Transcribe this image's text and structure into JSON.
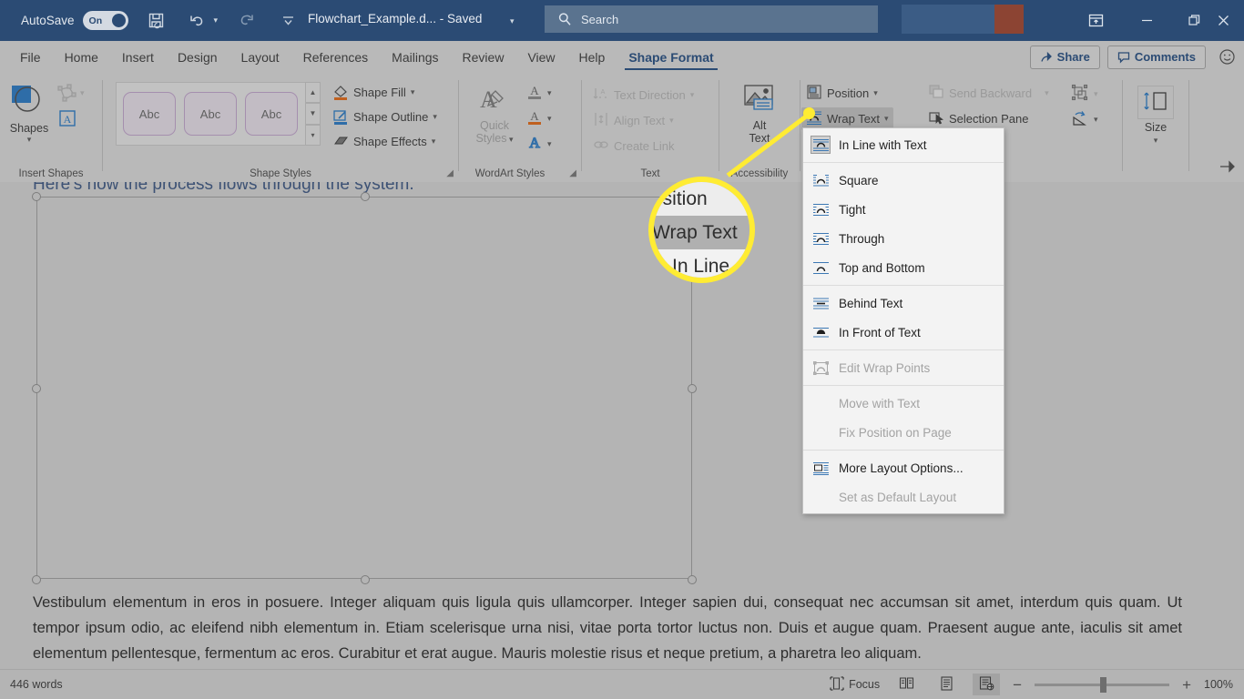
{
  "titlebar": {
    "autosave_label": "AutoSave",
    "autosave_state": "On",
    "doc_title": "Flowchart_Example.d... - Saved",
    "save_icon": "save-icon",
    "undo_icon": "undo-icon",
    "redo_icon": "redo-icon",
    "customize_icon": "customize-quick-access-icon",
    "search_icon": "search-icon",
    "search_placeholder": "Search",
    "ribbon_display_icon": "ribbon-display-options-icon",
    "minimize_icon": "minimize-icon",
    "restore_icon": "restore-icon",
    "close_icon": "close-icon"
  },
  "tabs": [
    {
      "label": "File",
      "active": false
    },
    {
      "label": "Home",
      "active": false
    },
    {
      "label": "Insert",
      "active": false
    },
    {
      "label": "Design",
      "active": false
    },
    {
      "label": "Layout",
      "active": false
    },
    {
      "label": "References",
      "active": false
    },
    {
      "label": "Mailings",
      "active": false
    },
    {
      "label": "Review",
      "active": false
    },
    {
      "label": "View",
      "active": false
    },
    {
      "label": "Help",
      "active": false
    },
    {
      "label": "Shape Format",
      "active": true
    }
  ],
  "tabbar_right": {
    "share_label": "Share",
    "share_icon": "share-icon",
    "comments_label": "Comments",
    "comments_icon": "comment-icon",
    "smiley_icon": "feedback-smiley-icon"
  },
  "ribbon": {
    "groups": [
      {
        "name": "Insert Shapes",
        "label": "Insert Shapes"
      },
      {
        "name": "Shape Styles",
        "label": "Shape Styles"
      },
      {
        "name": "WordArt Styles",
        "label": "WordArt Styles"
      },
      {
        "name": "Text",
        "label": "Text"
      },
      {
        "name": "Accessibility",
        "label": "Accessibility"
      },
      {
        "name": "Arrange",
        "label": ""
      },
      {
        "name": "Size",
        "label": ""
      }
    ],
    "insert_shapes": {
      "shapes_label": "Shapes",
      "shapes_icon": "shapes-icon",
      "edit_shape_icon": "edit-shape-icon",
      "text_box_icon": "draw-text-box-icon"
    },
    "shape_styles": {
      "gallery_items": [
        "Abc",
        "Abc",
        "Abc"
      ],
      "scroll_up_icon": "scroll-up-icon",
      "scroll_down_icon": "scroll-down-icon",
      "more_icon": "gallery-more-icon",
      "shape_fill": "Shape Fill",
      "shape_fill_icon": "shape-fill-icon",
      "shape_outline": "Shape Outline",
      "shape_outline_icon": "shape-outline-icon",
      "shape_effects": "Shape Effects",
      "shape_effects_icon": "shape-effects-icon",
      "dialog_launcher_icon": "dialog-launcher-icon"
    },
    "wordart_styles": {
      "quick_styles_line1": "Quick",
      "quick_styles_line2": "Styles",
      "quick_styles_icon": "wordart-quick-styles-icon",
      "text_fill_icon": "text-fill-icon",
      "text_outline_icon": "text-outline-icon",
      "text_effects_icon": "text-effects-icon",
      "dialog_launcher_icon": "dialog-launcher-icon"
    },
    "text_group": {
      "text_direction": "Text Direction",
      "text_direction_icon": "text-direction-icon",
      "align_text": "Align Text",
      "align_text_icon": "align-text-icon",
      "create_link": "Create Link",
      "create_link_icon": "create-link-icon"
    },
    "accessibility": {
      "alt_text_line1": "Alt",
      "alt_text_line2": "Text",
      "alt_text_icon": "alt-text-icon"
    },
    "arrange": {
      "position": "Position",
      "position_icon": "position-icon",
      "wrap_text": "Wrap Text",
      "wrap_text_icon": "wrap-text-icon",
      "bring_forward_icon": "bring-forward-icon",
      "send_backward": "Send Backward",
      "send_backward_icon": "send-backward-icon",
      "selection_pane": "Selection Pane",
      "selection_pane_icon": "selection-pane-icon",
      "align_objects_icon": "align-objects-icon",
      "group_icon": "group-objects-icon",
      "rotate_icon": "rotate-objects-icon"
    },
    "size": {
      "size_label": "Size",
      "size_icon": "size-icon"
    },
    "collapse_ribbon_icon": "pin-ribbon-icon"
  },
  "wrap_menu": {
    "items": [
      {
        "label": "In Line with Text",
        "icon": "wrap-inline-icon",
        "state": "selected"
      },
      {
        "label": "Square",
        "icon": "wrap-square-icon",
        "state": "normal"
      },
      {
        "label": "Tight",
        "icon": "wrap-tight-icon",
        "state": "normal"
      },
      {
        "label": "Through",
        "icon": "wrap-through-icon",
        "state": "normal"
      },
      {
        "label": "Top and Bottom",
        "icon": "wrap-top-bottom-icon",
        "state": "normal"
      },
      {
        "label": "Behind Text",
        "icon": "wrap-behind-text-icon",
        "state": "normal"
      },
      {
        "label": "In Front of Text",
        "icon": "wrap-in-front-icon",
        "state": "normal"
      },
      {
        "label": "Edit Wrap Points",
        "icon": "edit-wrap-points-icon",
        "state": "disabled"
      },
      {
        "label": "Move with Text",
        "icon": "",
        "state": "disabled"
      },
      {
        "label": "Fix Position on Page",
        "icon": "",
        "state": "disabled"
      },
      {
        "label": "More Layout Options...",
        "icon": "more-layout-options-icon",
        "state": "normal"
      },
      {
        "label": "Set as Default Layout",
        "icon": "",
        "state": "disabled"
      }
    ]
  },
  "callout": {
    "rows": [
      "osition",
      "Wrap Text",
      "In Line"
    ],
    "highlight_color": "#ffec33"
  },
  "document": {
    "heading": "Here's how the process flows through the system.",
    "body": "Vestibulum elementum in eros in posuere. Integer aliquam quis ligula quis ullamcorper. Integer sapien dui, consequat nec accumsan sit amet, interdum quis quam. Ut tempor ipsum odio, ac eleifend nibh elementum in. Etiam scelerisque urna nisi, vitae porta tortor luctus non. Duis et augue quam. Praesent augue ante, iaculis sit amet elementum pellentesque, fermentum ac eros. Curabitur et erat augue. Mauris molestie risus et neque pretium, a pharetra leo aliquam."
  },
  "statusbar": {
    "word_count": "446 words",
    "focus_label": "Focus",
    "focus_icon": "focus-mode-icon",
    "read_mode_icon": "read-mode-icon",
    "print_layout_icon": "print-layout-icon",
    "web_layout_icon": "web-layout-icon",
    "zoom_out_icon": "zoom-out-icon",
    "zoom_in_icon": "zoom-in-icon",
    "zoom_level": "100%"
  },
  "colors": {
    "titlebar": "#2b4b74",
    "ribbon": "#b9b9b9",
    "accent": "#2b4b74",
    "callout": "#ffec33",
    "heading_text": "#3d5275"
  }
}
